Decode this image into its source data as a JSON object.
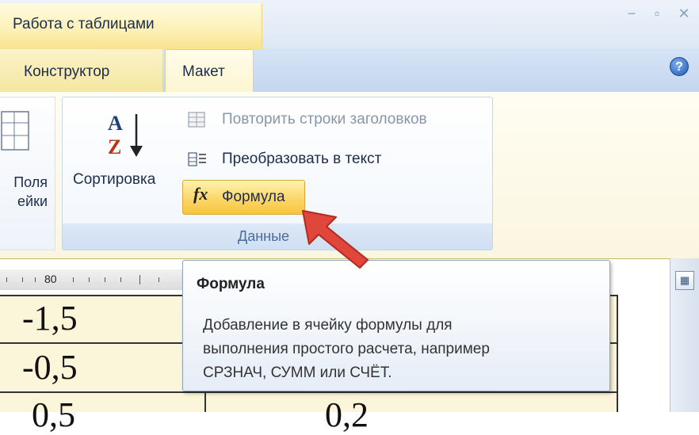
{
  "window": {
    "context_tab": "Работа с таблицами",
    "minimize": "−",
    "restore": "▫",
    "close": "✕"
  },
  "tabs": [
    {
      "label": "Конструктор"
    },
    {
      "label": "Макет"
    }
  ],
  "help_label": "?",
  "ribbon": {
    "cell_margins": {
      "line1": "Поля",
      "line2": "ейки"
    },
    "data_group": {
      "title": "Данные",
      "sort_label": "Сортировка",
      "sort_icon_letters": {
        "top": "A",
        "bottom": "Z"
      },
      "repeat_header_rows": "Повторить строки заголовков",
      "convert_to_text": "Преобразовать в текст",
      "formula": "Формула",
      "formula_icon": "fx"
    }
  },
  "ruler": {
    "number": "80"
  },
  "table": {
    "cells": [
      "-1,5",
      "-0,5",
      "0,5",
      "0,2"
    ]
  },
  "tooltip": {
    "title": "Формула",
    "lines": [
      "Добавление в ячейку формулы для",
      "выполнения простого расчета, например",
      "СРЗНАЧ, СУММ или СЧЁТ."
    ]
  },
  "colors": {
    "accent_highlight": "#fcd66a",
    "arrow": "#e0463a",
    "ribbon_blue": "#c5d6ee"
  }
}
